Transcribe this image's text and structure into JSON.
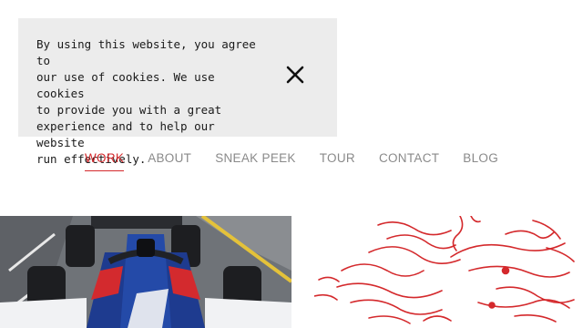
{
  "cookie_banner": {
    "text": "By using this website, you agree to\nour use of cookies. We use cookies\nto provide you with a great\nexperience and to help our website\nrun effectively.",
    "close_icon": "close-icon"
  },
  "nav": {
    "items": [
      {
        "label": "WORK",
        "active": true
      },
      {
        "label": "ABOUT",
        "active": false
      },
      {
        "label": "SNEAK PEEK",
        "active": false
      },
      {
        "label": "TOUR",
        "active": false
      },
      {
        "label": "CONTACT",
        "active": false
      },
      {
        "label": "BLOG",
        "active": false
      }
    ]
  },
  "colors": {
    "accent": "#d4292c",
    "nav_text": "#8a8a8a",
    "banner_bg": "#ececec"
  }
}
